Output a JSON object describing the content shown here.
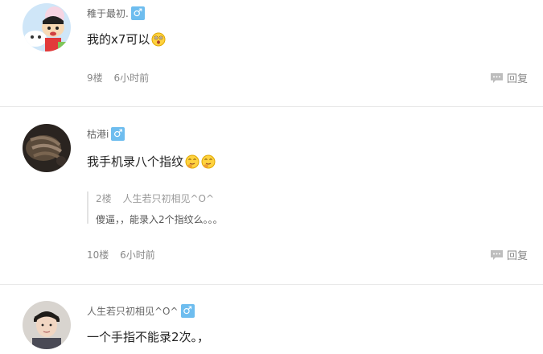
{
  "comments": [
    {
      "username": "稚于最初.",
      "content": "我的x7可以",
      "floor": "9楼",
      "time": "6小时前",
      "reply_label": "回复"
    },
    {
      "username": "枯港i",
      "content": "我手机录八个指纹",
      "quote": {
        "floor": "2楼",
        "author": "人生若只初相见^O^",
        "text": "傻逼，，能录入2个指纹么。。。"
      },
      "floor": "10楼",
      "time": "6小时前",
      "reply_label": "回复"
    },
    {
      "username": "人生若只初相见^O^",
      "content": "一个手指不能录2次。，"
    }
  ],
  "badge_symbol": "♂",
  "icons": {
    "gender": "male-icon",
    "reply": "comment-bubble-icon",
    "emoji_1": "surprised-face-icon",
    "emoji_2": "thinking-face-icon"
  },
  "colors": {
    "badge": "#6ebdef",
    "meta_text": "#888888",
    "content_text": "#222222"
  }
}
